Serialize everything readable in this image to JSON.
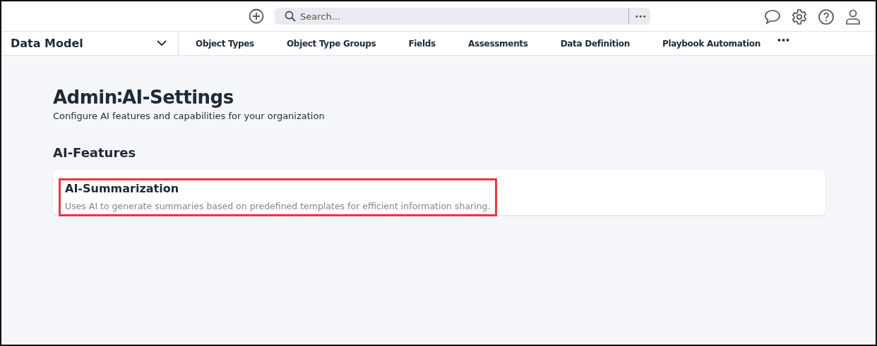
{
  "top_bar": {
    "search": {
      "placeholder": "Search..."
    },
    "more_label": "•••"
  },
  "nav": {
    "module": "Data Model",
    "tabs": [
      {
        "label": "Object Types",
        "selected": false
      },
      {
        "label": "Object Type Groups",
        "selected": false
      },
      {
        "label": "Fields",
        "selected": false
      },
      {
        "label": "Assessments",
        "selected": false
      },
      {
        "label": "Data Definition",
        "selected": false
      },
      {
        "label": "Playbook Automation",
        "selected": false
      }
    ],
    "more_label": "•••"
  },
  "page": {
    "title": "Admin∶AI-Settings",
    "subtitle": "Configure AI features and capabilities for your organization",
    "section_title": "AI-Features",
    "features": [
      {
        "name": "AI-Summarization",
        "description": "Uses AI to generate summaries based on predefined templates for efficient information sharing.",
        "highlighted": true
      }
    ]
  }
}
